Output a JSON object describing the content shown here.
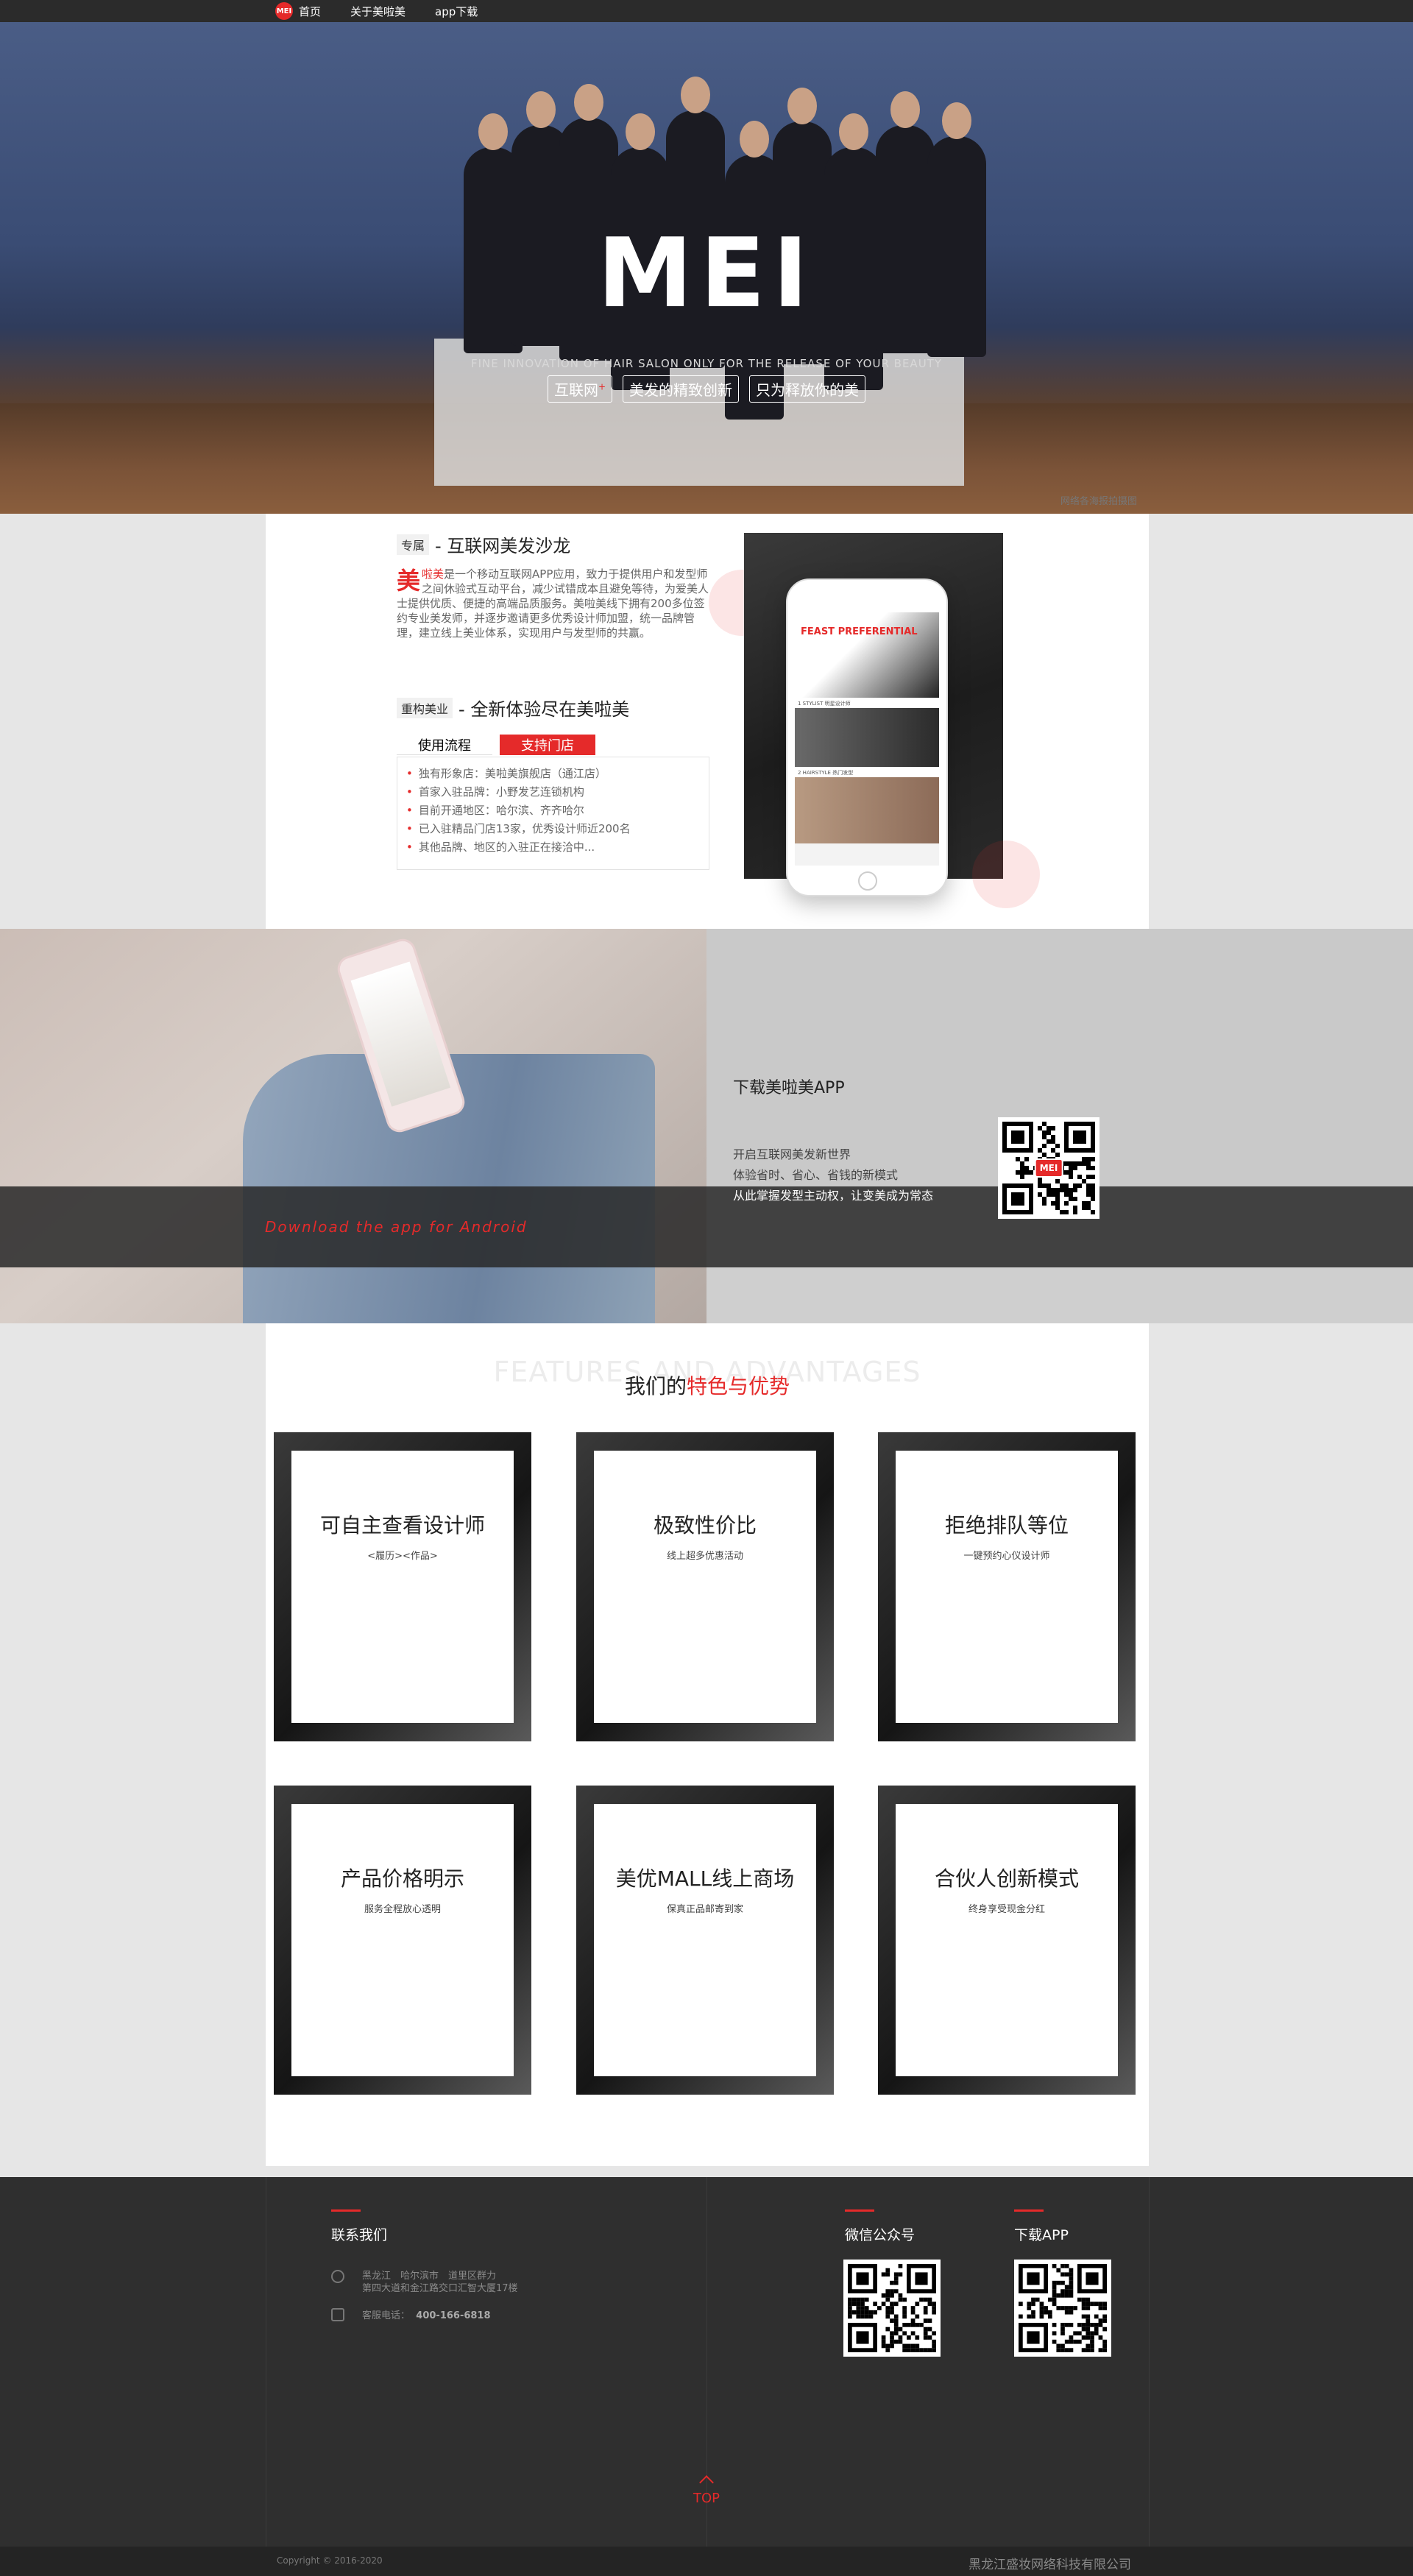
{
  "nav": {
    "logo_text": "MEI",
    "items": [
      {
        "label": "首页"
      },
      {
        "label": "关于美啦美"
      },
      {
        "label": "app下载"
      }
    ]
  },
  "hero": {
    "logo_text": "MEI",
    "subtitle": "FINE INNOVATION OF HAIR SALON ONLY FOR THE RELEASE OF YOUR BEAUTY",
    "tags": [
      "互联网",
      "美发的精致创新",
      "只为释放你的美"
    ],
    "tag_sup": "+",
    "credit": "网络各海报拍摄图"
  },
  "intro": {
    "section1_small": "专属",
    "section1_big": "互联网美发沙龙",
    "desc_mei": "美",
    "desc_brand": "啦美",
    "desc_body": "是一个移动互联网APP应用，致力于提供用户和发型师之间休验式互动平台，减少试错成本且避免等待，为爱美人士提供优质、便捷的高端品质服务。美啦美线下拥有200多位签约专业美发师，并逐步邀请更多优秀设计师加盟，统一品牌管理，建立线上美业体系，实现用户与发型师的共赢。",
    "section2_small": "重构美业",
    "section2_big": "全新体验尽在美啦美",
    "tabs": [
      "使用流程",
      "支持门店"
    ],
    "active_tab": "支持门店",
    "store_list": [
      "独有形象店：美啦美旗舰店（通江店）",
      "首家入驻品牌：小野发艺连锁机构",
      "目前开通地区：哈尔滨、齐齐哈尔",
      "已入驻精品门店13家，优秀设计师近200名",
      "其他品牌、地区的入驻正在接洽中..."
    ],
    "phone_screen_text": "FEAST PREFERENTIAL",
    "phone_row1": "1 STYLIST 明星设计师",
    "phone_row2": "2 HAIRSTYLE 热门发型"
  },
  "download": {
    "script_text": "Download the app for Android",
    "title": "下载美啦美APP",
    "lines": [
      "开启互联网美发新世界",
      "体验省时、省心、省钱的新模式",
      "从此掌握发型主动权，让变美成为常态"
    ],
    "qr_badge": "MEI"
  },
  "features": {
    "heading_en": "FEATURES AND ADVANTAGES",
    "heading_cn_prefix": "我们的",
    "heading_cn_highlight": "特色与优势",
    "cards": [
      {
        "title": "可自主查看设计师",
        "sub": "<履历><作品>"
      },
      {
        "title": "极致性价比",
        "sub": "线上超多优惠活动"
      },
      {
        "title": "拒绝排队等位",
        "sub": "一键预约心仪设计师"
      },
      {
        "title": "产品价格明示",
        "sub": "服务全程放心透明"
      },
      {
        "title": "美优MALL线上商场",
        "sub": "保真正品邮寄到家"
      },
      {
        "title": "合伙人创新模式",
        "sub": "终身享受现金分红"
      }
    ]
  },
  "footer": {
    "contact_title": "联系我们",
    "address_line1": "黑龙江　哈尔滨市　道里区群力",
    "address_line2": "第四大道和金江路交口汇智大厦17楼",
    "phone_label": "客服电话：",
    "phone_value": "400-166-6818",
    "wechat_title": "微信公众号",
    "app_title": "下载APP",
    "top_label": "TOP",
    "copyright": "Copyright © 2016-2020",
    "company": "黑龙江盛妆网络科技有限公司"
  },
  "colors": {
    "accent": "#e52a2a",
    "dark": "#2f2f2f"
  }
}
